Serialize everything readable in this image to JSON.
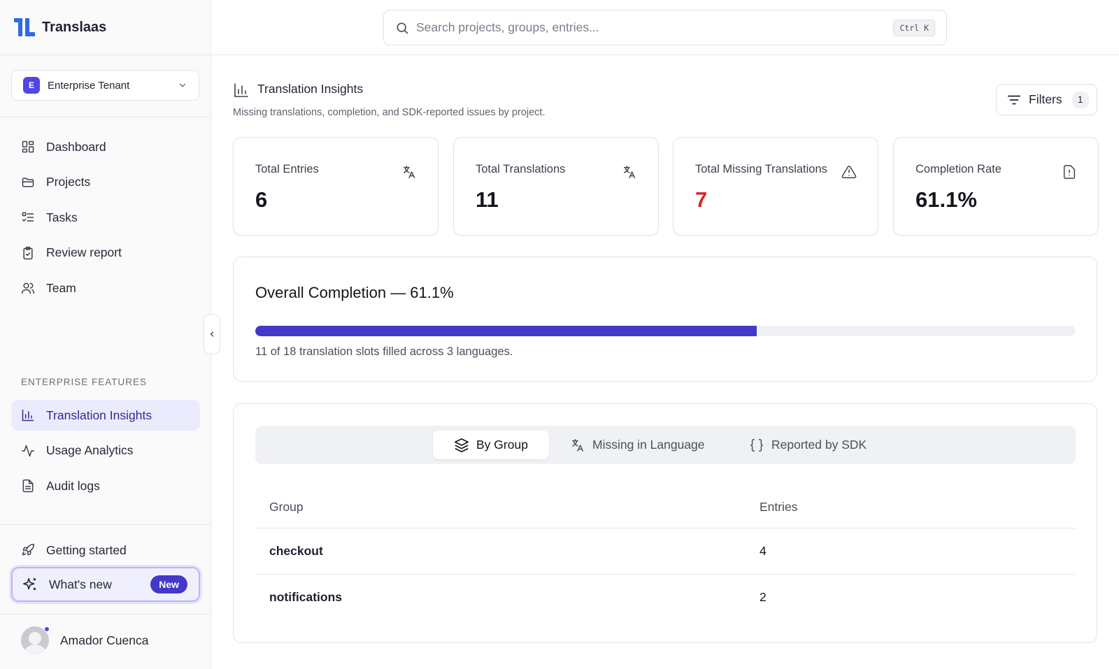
{
  "app": {
    "name": "Translaas"
  },
  "tenant": {
    "badge": "E",
    "name": "Enterprise Tenant"
  },
  "nav": {
    "main": [
      {
        "label": "Dashboard",
        "icon": "dashboard-icon"
      },
      {
        "label": "Projects",
        "icon": "folder-icon"
      },
      {
        "label": "Tasks",
        "icon": "tasks-icon"
      },
      {
        "label": "Review report",
        "icon": "clipboard-check-icon"
      },
      {
        "label": "Team",
        "icon": "users-icon"
      }
    ],
    "section_label": "ENTERPRISE FEATURES",
    "enterprise": [
      {
        "label": "Translation Insights",
        "icon": "bar-chart-icon",
        "active": true
      },
      {
        "label": "Usage Analytics",
        "icon": "activity-icon"
      },
      {
        "label": "Audit logs",
        "icon": "document-icon"
      }
    ],
    "footer": [
      {
        "label": "Getting started",
        "icon": "rocket-icon"
      }
    ],
    "whats_new": {
      "label": "What's new",
      "badge": "New",
      "icon": "sparkles-icon"
    }
  },
  "user": {
    "name": "Amador Cuenca"
  },
  "search": {
    "placeholder": "Search projects, groups, entries...",
    "shortcut": "Ctrl K"
  },
  "page": {
    "title": "Translation Insights",
    "subtitle": "Missing translations, completion, and SDK-reported issues by project.",
    "filters": {
      "label": "Filters",
      "count": "1"
    }
  },
  "stats": [
    {
      "label": "Total Entries",
      "value": "6",
      "icon": "translate-icon"
    },
    {
      "label": "Total Translations",
      "value": "11",
      "icon": "translate-icon"
    },
    {
      "label": "Total Missing Translations",
      "value": "7",
      "icon": "warning-icon",
      "highlight": "#d02a2a"
    },
    {
      "label": "Completion Rate",
      "value": "61.1%",
      "icon": "file-alert-icon"
    }
  ],
  "overall": {
    "title": "Overall Completion — 61.1%",
    "progress": 0.611,
    "note": "11 of 18 translation slots filled across 3 languages."
  },
  "tabs": [
    {
      "label": "By Group",
      "icon": "layers-icon",
      "active": true
    },
    {
      "label": "Missing in Language",
      "icon": "translate-icon"
    },
    {
      "label": "Reported by SDK",
      "icon": "braces-icon"
    }
  ],
  "table": {
    "columns": [
      "Group",
      "Entries"
    ],
    "rows": [
      [
        "checkout",
        "4"
      ],
      [
        "notifications",
        "2"
      ]
    ]
  },
  "colors": {
    "accent": "#4338ca",
    "brand": "#2f6ae6",
    "danger": "#d02a2a",
    "active_bg": "#ecebfd"
  }
}
